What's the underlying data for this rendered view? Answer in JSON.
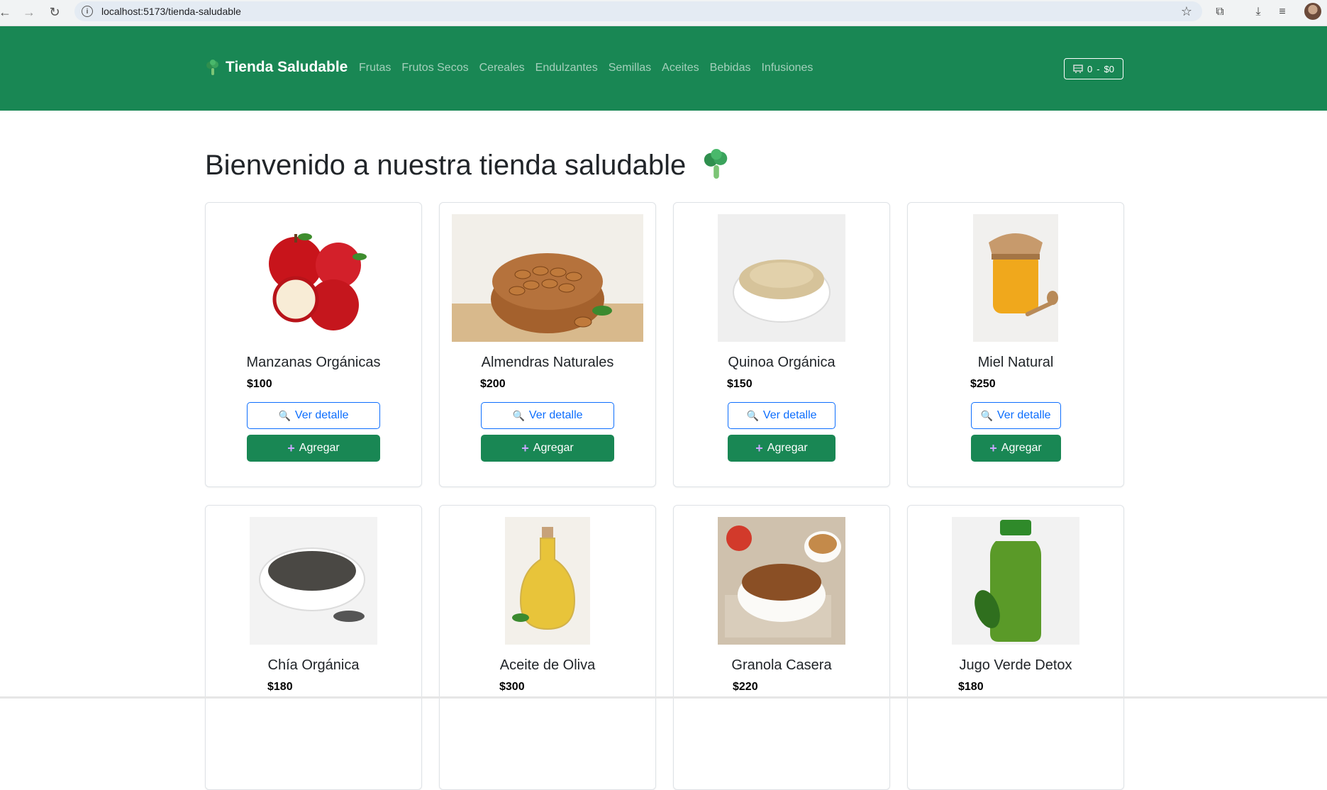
{
  "browser": {
    "url": "localhost:5173/tienda-saludable"
  },
  "navbar": {
    "brand": "Tienda Saludable",
    "brand_icon": "broccoli-icon",
    "links": [
      "Frutas",
      "Frutos Secos",
      "Cereales",
      "Endulzantes",
      "Semillas",
      "Aceites",
      "Bebidas",
      "Infusiones"
    ],
    "cart_count": "0",
    "cart_separator": "-",
    "cart_total": "$0",
    "color": "#198754"
  },
  "main": {
    "title": "Bienvenido a nuestra tienda saludable",
    "title_icon": "broccoli-icon"
  },
  "buttons": {
    "detail_label": "Ver detalle",
    "add_label": "Agregar"
  },
  "products": [
    {
      "name": "Manzanas Orgánicas",
      "price": "$100",
      "image": "apples-image"
    },
    {
      "name": "Almendras Naturales",
      "price": "$200",
      "image": "almonds-image"
    },
    {
      "name": "Quinoa Orgánica",
      "price": "$150",
      "image": "quinoa-image"
    },
    {
      "name": "Miel Natural",
      "price": "$250",
      "image": "honey-image"
    },
    {
      "name": "Chía Orgánica",
      "price": "$180",
      "image": "chia-image"
    },
    {
      "name": "Aceite de Oliva",
      "price": "$300",
      "image": "olive-oil-image"
    },
    {
      "name": "Granola Casera",
      "price": "$220",
      "image": "granola-image"
    },
    {
      "name": "Jugo Verde Detox",
      "price": "$180",
      "image": "green-juice-image"
    }
  ]
}
